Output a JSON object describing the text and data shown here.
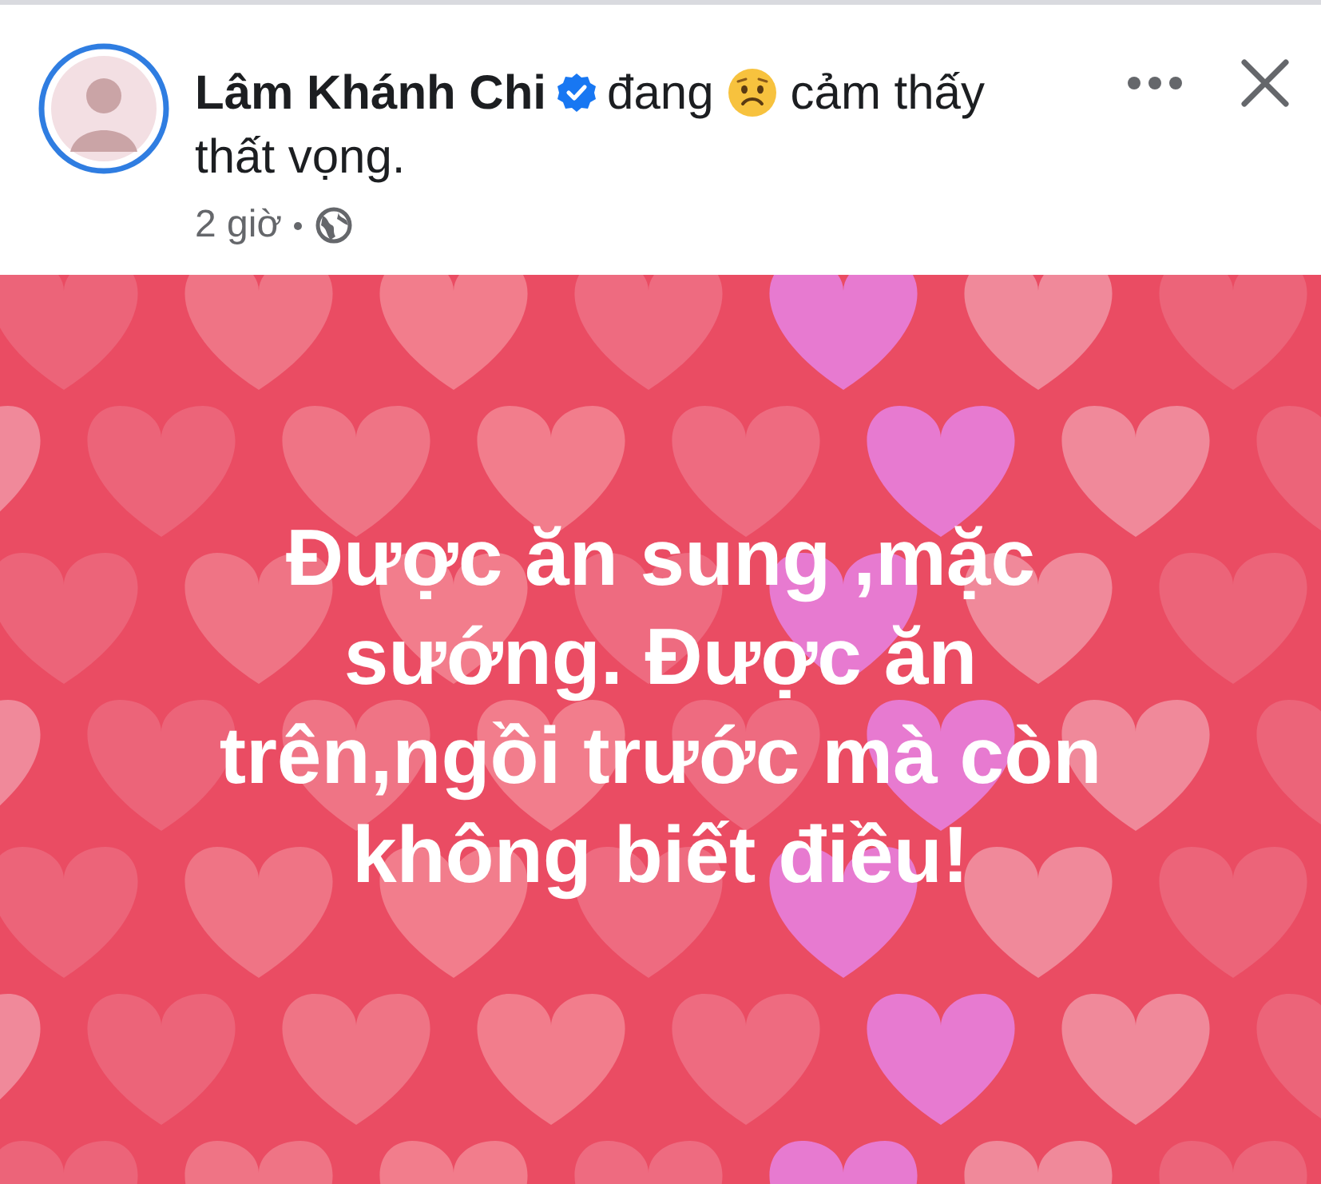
{
  "post": {
    "author": "Lâm Khánh Chi",
    "verified": true,
    "activity_verb": "đang",
    "feeling": "cảm thấy",
    "feeling_line_2": "thất vọng.",
    "time": "2 giờ"
  },
  "status_background": {
    "kind": "hearts",
    "text_lines": [
      "Được ăn sung ,mặc",
      "sướng. Được ăn",
      "trên,ngồi trước mà còn",
      "không biết điều!"
    ]
  }
}
